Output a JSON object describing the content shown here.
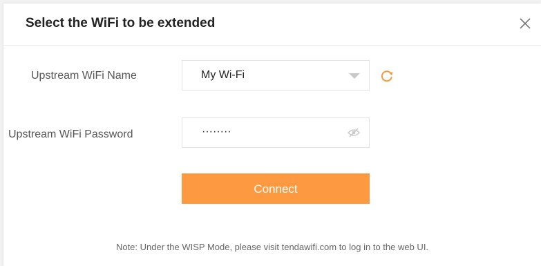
{
  "dialog": {
    "title": "Select the WiFi to be extended",
    "close_icon": "close-icon"
  },
  "form": {
    "name_label": "Upstream WiFi Name",
    "name_value": "My Wi-Fi",
    "refresh_icon": "refresh-icon",
    "password_label": "Upstream WiFi Password",
    "password_value": "········",
    "eye_icon": "eye-hidden-icon",
    "connect_label": "Connect"
  },
  "note": "Note: Under the WISP Mode, please visit tendawifi.com to log in to the web UI.",
  "colors": {
    "accent": "#fd9a41",
    "refresh": "#f49a3c"
  }
}
